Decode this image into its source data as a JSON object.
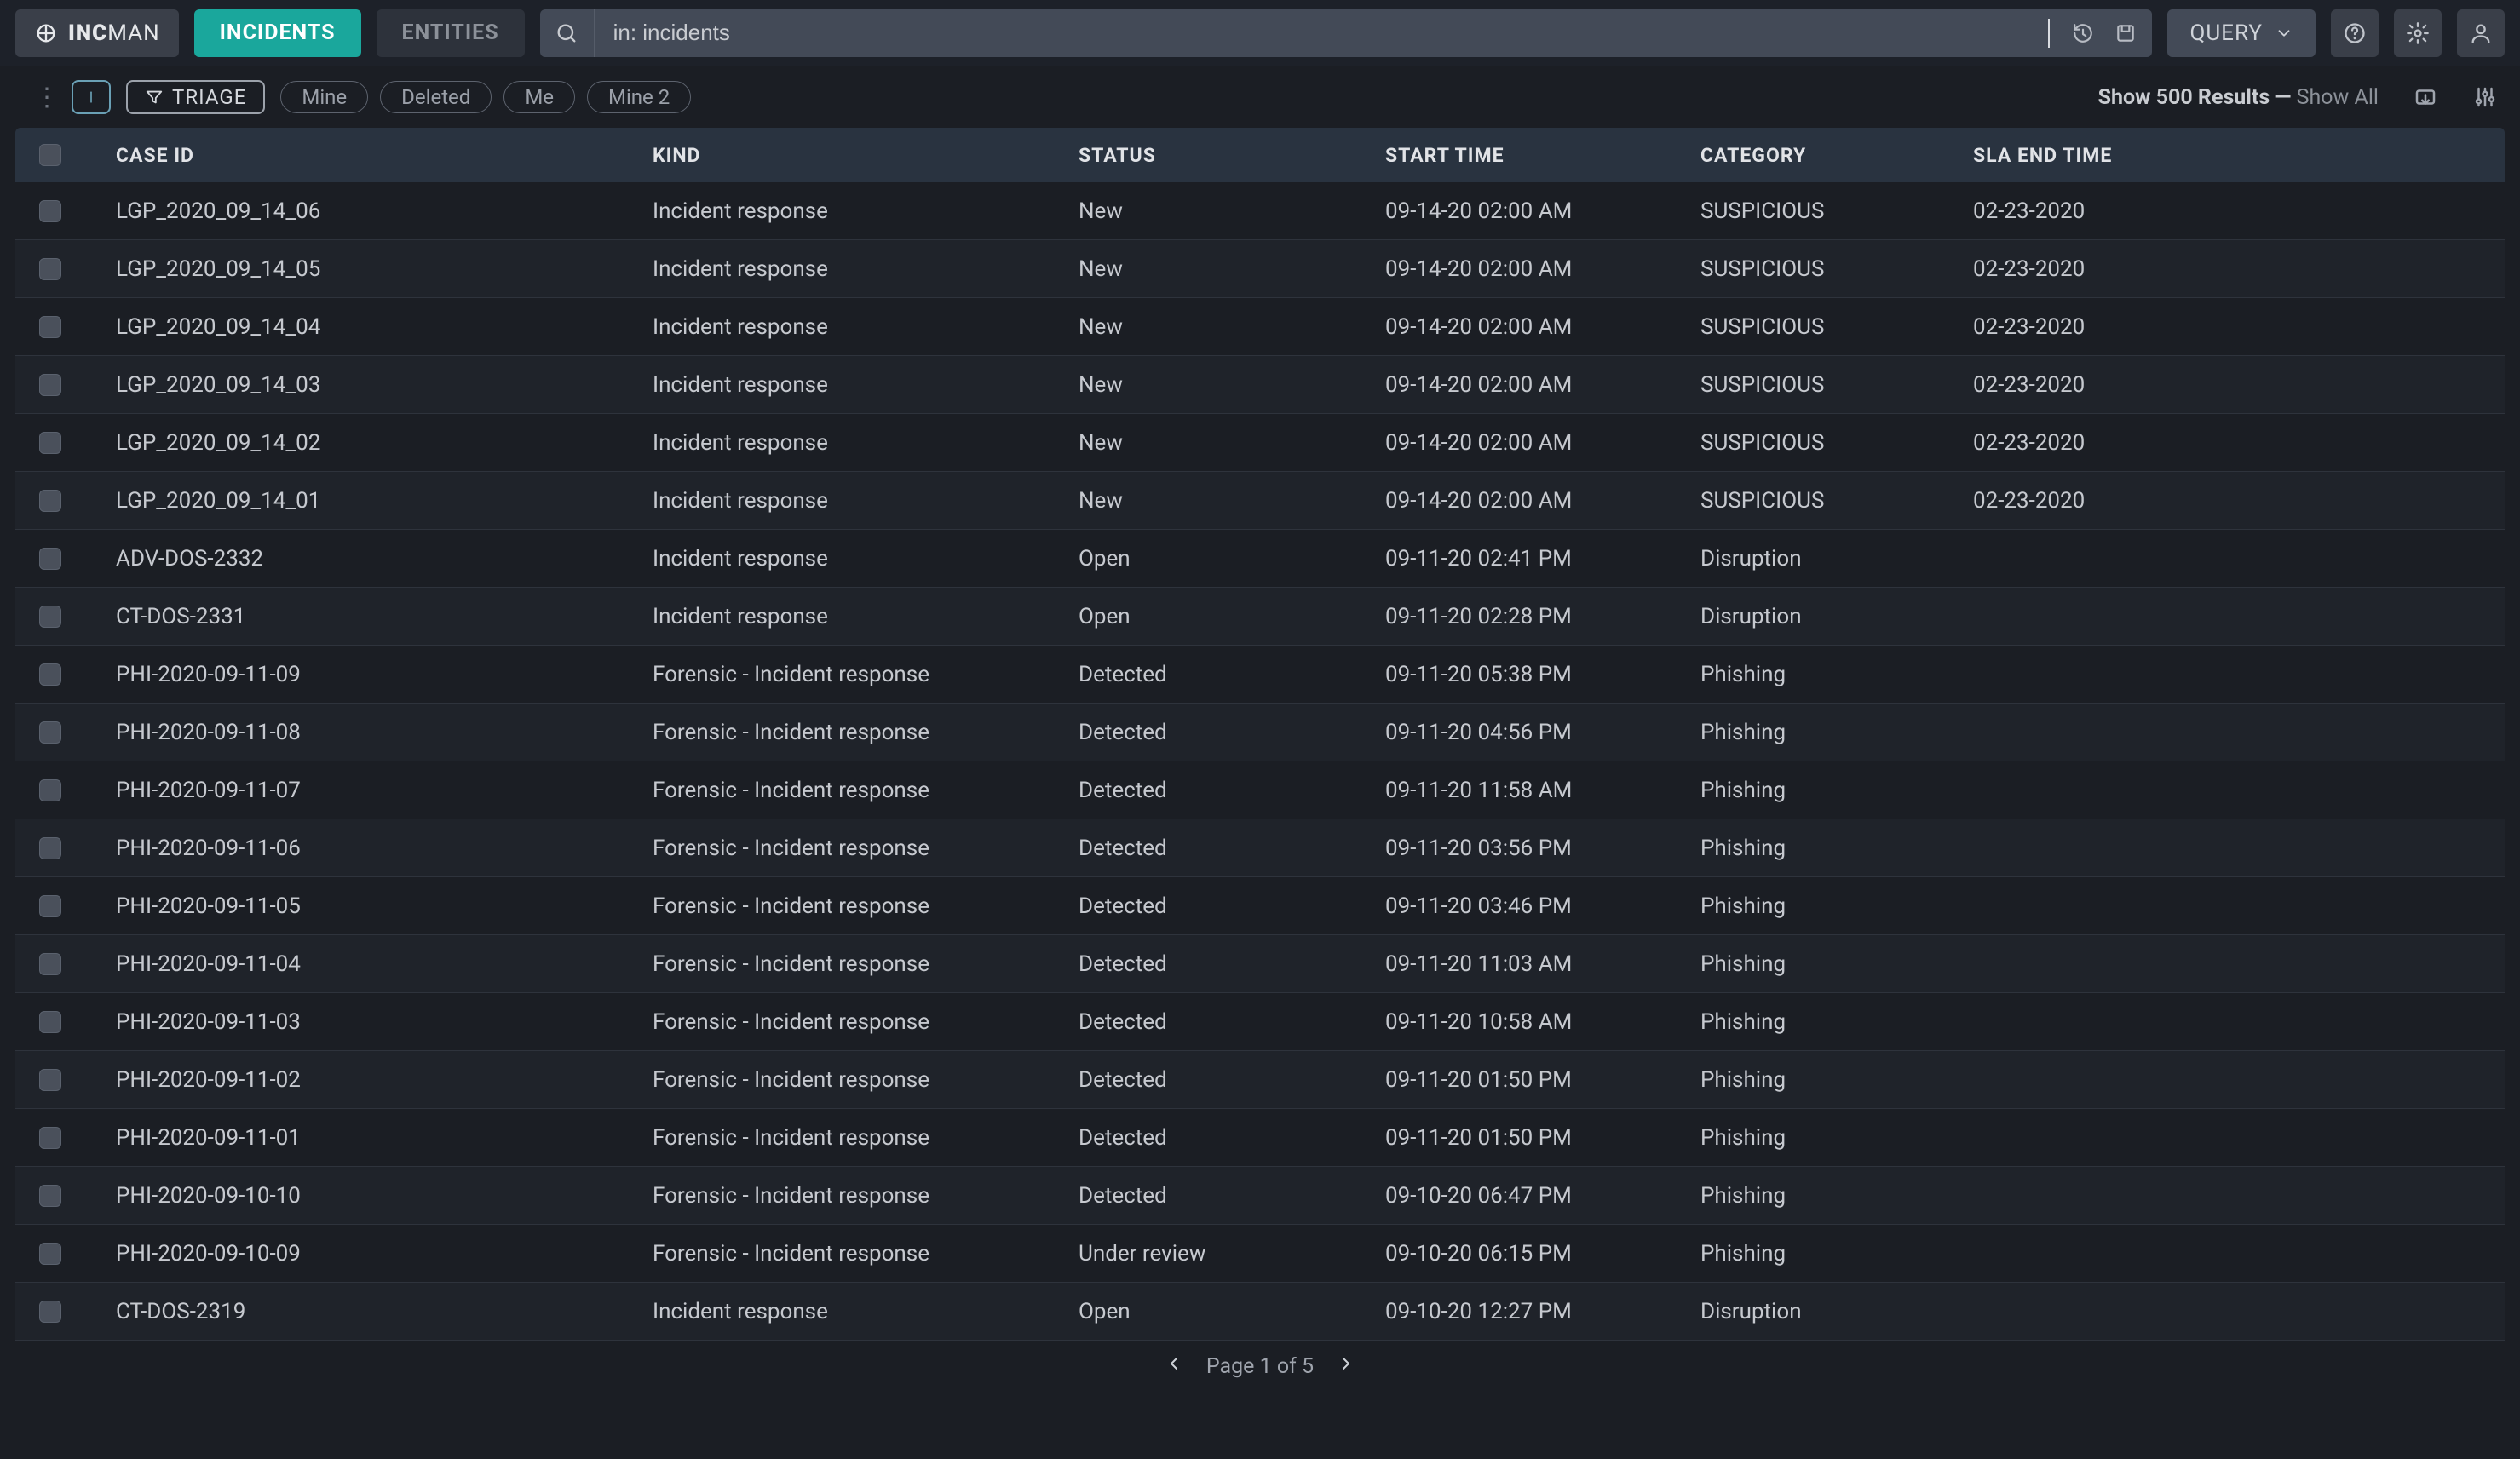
{
  "brand": {
    "prefix": "INC",
    "suffix": "MAN"
  },
  "nav": {
    "incidents": "INCIDENTS",
    "entities": "ENTITIES"
  },
  "search": {
    "value": "in: incidents"
  },
  "query_btn": "QUERY",
  "toolbar": {
    "triage": "TRIAGE",
    "chips": [
      "Mine",
      "Deleted",
      "Me",
      "Mine 2"
    ],
    "results_prefix": "Show 500 Results —",
    "results_showall": "Show All"
  },
  "columns": [
    "CASE ID",
    "KIND",
    "STATUS",
    "START TIME",
    "CATEGORY",
    "SLA END TIME"
  ],
  "rows": [
    {
      "id": "LGP_2020_09_14_06",
      "kind": "Incident response",
      "status": "New",
      "start": "09-14-20 02:00 AM",
      "cat": "SUSPICIOUS",
      "sla": "02-23-2020"
    },
    {
      "id": "LGP_2020_09_14_05",
      "kind": "Incident response",
      "status": "New",
      "start": "09-14-20 02:00 AM",
      "cat": "SUSPICIOUS",
      "sla": "02-23-2020"
    },
    {
      "id": "LGP_2020_09_14_04",
      "kind": "Incident response",
      "status": "New",
      "start": "09-14-20 02:00 AM",
      "cat": "SUSPICIOUS",
      "sla": "02-23-2020"
    },
    {
      "id": "LGP_2020_09_14_03",
      "kind": "Incident response",
      "status": "New",
      "start": "09-14-20 02:00 AM",
      "cat": "SUSPICIOUS",
      "sla": "02-23-2020"
    },
    {
      "id": "LGP_2020_09_14_02",
      "kind": "Incident response",
      "status": "New",
      "start": "09-14-20 02:00 AM",
      "cat": "SUSPICIOUS",
      "sla": "02-23-2020"
    },
    {
      "id": "LGP_2020_09_14_01",
      "kind": "Incident response",
      "status": "New",
      "start": "09-14-20 02:00 AM",
      "cat": "SUSPICIOUS",
      "sla": "02-23-2020"
    },
    {
      "id": "ADV-DOS-2332",
      "kind": "Incident response",
      "status": "Open",
      "start": "09-11-20 02:41 PM",
      "cat": "Disruption",
      "sla": ""
    },
    {
      "id": "CT-DOS-2331",
      "kind": "Incident response",
      "status": "Open",
      "start": "09-11-20 02:28 PM",
      "cat": "Disruption",
      "sla": ""
    },
    {
      "id": "PHI-2020-09-11-09",
      "kind": "Forensic - Incident response",
      "status": "Detected",
      "start": "09-11-20 05:38 PM",
      "cat": "Phishing",
      "sla": ""
    },
    {
      "id": "PHI-2020-09-11-08",
      "kind": "Forensic - Incident response",
      "status": "Detected",
      "start": "09-11-20 04:56 PM",
      "cat": "Phishing",
      "sla": ""
    },
    {
      "id": "PHI-2020-09-11-07",
      "kind": "Forensic - Incident response",
      "status": "Detected",
      "start": "09-11-20 11:58 AM",
      "cat": "Phishing",
      "sla": ""
    },
    {
      "id": "PHI-2020-09-11-06",
      "kind": "Forensic - Incident response",
      "status": "Detected",
      "start": "09-11-20 03:56 PM",
      "cat": "Phishing",
      "sla": ""
    },
    {
      "id": "PHI-2020-09-11-05",
      "kind": "Forensic - Incident response",
      "status": "Detected",
      "start": "09-11-20 03:46 PM",
      "cat": "Phishing",
      "sla": ""
    },
    {
      "id": "PHI-2020-09-11-04",
      "kind": "Forensic - Incident response",
      "status": "Detected",
      "start": "09-11-20 11:03 AM",
      "cat": "Phishing",
      "sla": ""
    },
    {
      "id": "PHI-2020-09-11-03",
      "kind": "Forensic - Incident response",
      "status": "Detected",
      "start": "09-11-20 10:58 AM",
      "cat": "Phishing",
      "sla": ""
    },
    {
      "id": "PHI-2020-09-11-02",
      "kind": "Forensic - Incident response",
      "status": "Detected",
      "start": "09-11-20 01:50 PM",
      "cat": "Phishing",
      "sla": ""
    },
    {
      "id": "PHI-2020-09-11-01",
      "kind": "Forensic - Incident response",
      "status": "Detected",
      "start": "09-11-20 01:50 PM",
      "cat": "Phishing",
      "sla": ""
    },
    {
      "id": "PHI-2020-09-10-10",
      "kind": "Forensic - Incident response",
      "status": "Detected",
      "start": "09-10-20 06:47 PM",
      "cat": "Phishing",
      "sla": ""
    },
    {
      "id": "PHI-2020-09-10-09",
      "kind": "Forensic - Incident response",
      "status": "Under review",
      "start": "09-10-20 06:15 PM",
      "cat": "Phishing",
      "sla": ""
    },
    {
      "id": "CT-DOS-2319",
      "kind": "Incident response",
      "status": "Open",
      "start": "09-10-20 12:27 PM",
      "cat": "Disruption",
      "sla": ""
    }
  ],
  "footer": {
    "page_text": "Page 1 of 5"
  }
}
